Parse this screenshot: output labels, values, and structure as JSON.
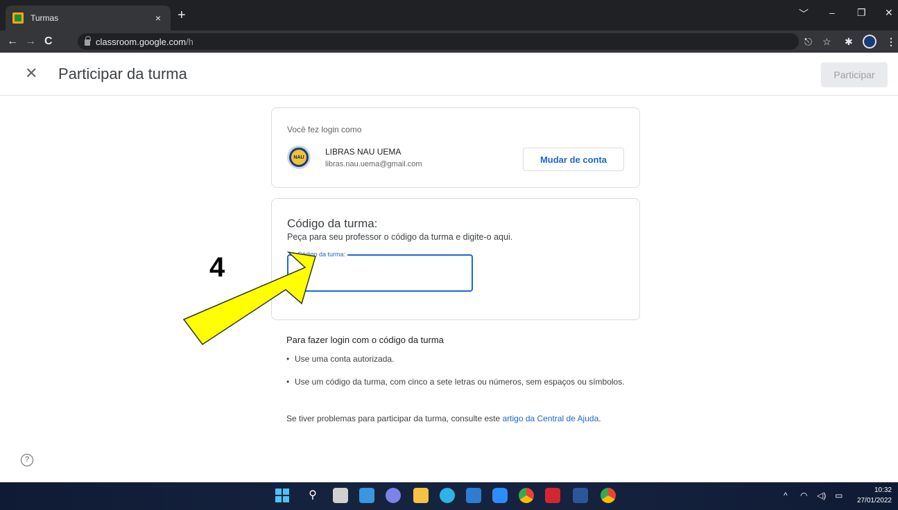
{
  "browser": {
    "tab_title": "Turmas",
    "tab_close": "×",
    "new_tab": "+",
    "url_host": "classroom.google.com",
    "url_path": "/h",
    "back": "←",
    "forward": "→",
    "reload": "C",
    "window_controls": [
      "﹀",
      "–",
      "❐",
      "✕"
    ],
    "toolbar_icons": [
      "share-icon",
      "star-icon",
      "extensions-icon",
      "profile-icon",
      "menu-icon"
    ]
  },
  "header": {
    "close_symbol": "✕",
    "title": "Participar da turma",
    "join_label": "Participar"
  },
  "account": {
    "logged_in_as": "Você fez login como",
    "name": "LIBRAS NAU UEMA",
    "email": "libras.nau.uema@gmail.com",
    "avatar_text": "NAU",
    "switch_label": "Mudar de conta"
  },
  "class_code": {
    "heading": "Código da turma:",
    "description": "Peça para seu professor o código da turma e digite-o aqui.",
    "field_label": "Código da turma:",
    "value": ""
  },
  "help": {
    "title": "Para fazer login com o código da turma",
    "items": [
      "Use uma conta autorizada.",
      "Use um código da turma, com cinco a sete letras ou números, sem espaços ou símbolos."
    ],
    "bullet": "•",
    "footer_prefix": "Se tiver problemas para participar da turma, consulte este ",
    "footer_link": "artigo da Central de Ajuda",
    "footer_suffix": "."
  },
  "overlay": {
    "number": "4",
    "arrow_color": "#ffff00"
  },
  "help_button": "?",
  "taskbar": {
    "apps": [
      "windows-start-icon",
      "search-icon",
      "task-view-icon",
      "widgets-icon",
      "teams-chat-icon",
      "file-explorer-icon",
      "edge-icon",
      "store-icon",
      "zoom-icon",
      "chrome-icon",
      "acrobat-icon",
      "word-icon",
      "chrome-profile-icon"
    ],
    "system_tray": [
      "^",
      "wifi-icon",
      "volume-icon",
      "battery-icon"
    ],
    "time": "10:32",
    "date": "27/01/2022"
  },
  "colors": {
    "accent": "#1967d2",
    "disabled_button": "#e8eaed"
  }
}
